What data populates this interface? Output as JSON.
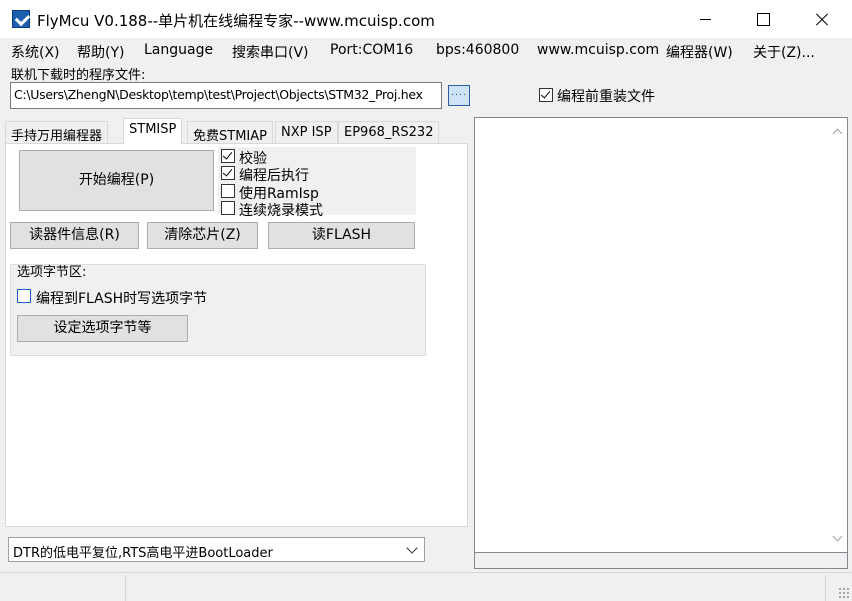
{
  "window": {
    "title": "FlyMcu V0.188--单片机在线编程专家--www.mcuisp.com"
  },
  "menu": [
    "系统(X)",
    "帮助(Y)",
    "Language",
    "搜索串口(V)",
    "Port:COM16",
    "bps:460800",
    "www.mcuisp.com",
    "编程器(W)",
    "关于(Z)..."
  ],
  "file": {
    "label": "联机下载时的程序文件:",
    "path": "C:\\Users\\ZhengN\\Desktop\\temp\\test\\Project\\Objects\\STM32_Proj.hex",
    "browse_label": "....",
    "reload_label": "编程前重装文件",
    "reload_checked": true
  },
  "tabs": [
    "手持万用编程器",
    "STMISP",
    "免费STMIAP",
    "NXP ISP",
    "EP968_RS232"
  ],
  "active_tab": "STMISP",
  "stmisp": {
    "start_button": "开始编程(P)",
    "options": [
      {
        "label": "校验",
        "checked": true
      },
      {
        "label": "编程后执行",
        "checked": true
      },
      {
        "label": "使用RamIsp",
        "checked": false
      },
      {
        "label": "连续烧录模式",
        "checked": false
      }
    ],
    "read_info_button": "读器件信息(R)",
    "erase_button": "清除芯片(Z)",
    "read_flash_button": "读FLASH",
    "option_bytes": {
      "title": "选项字节区:",
      "write_label": "编程到FLASH时写选项字节",
      "write_checked": false,
      "settings_button": "设定选项字节等"
    }
  },
  "reset_mode": {
    "selected": "DTR的低电平复位,RTS高电平进BootLoader"
  },
  "colors": {
    "window_bg": "#f0f0f0",
    "button_bg": "#e1e1e1",
    "checkbox_blue": "#1a5ec4",
    "icon_blue": "#1d5fae"
  }
}
